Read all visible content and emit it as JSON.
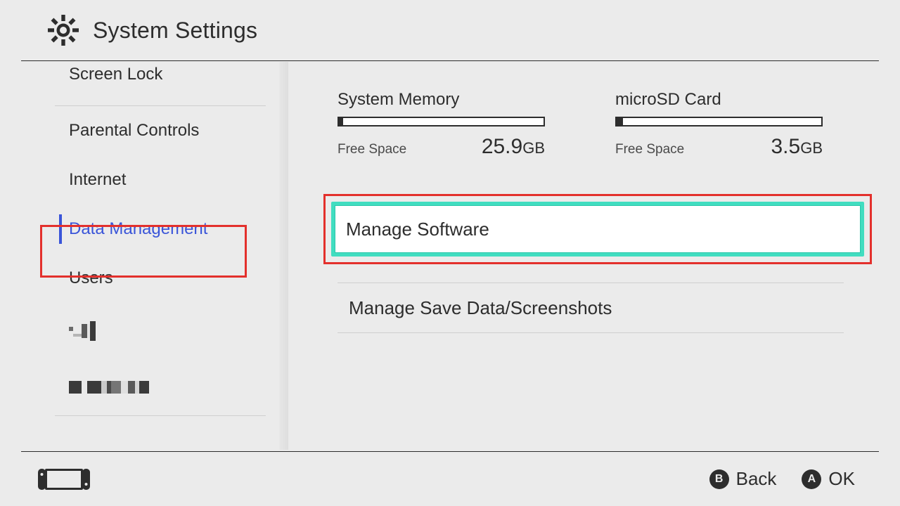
{
  "header": {
    "title": "System Settings"
  },
  "sidebar": {
    "items": [
      {
        "label": "Screen Lock"
      },
      {
        "label": "Parental Controls"
      },
      {
        "label": "Internet"
      },
      {
        "label": "Data Management"
      },
      {
        "label": "Users"
      }
    ]
  },
  "storage": {
    "system": {
      "title": "System Memory",
      "free_label": "Free Space",
      "free_value": "25.9",
      "free_unit": "GB",
      "used_pct": 2
    },
    "sd": {
      "title": "microSD Card",
      "free_label": "Free Space",
      "free_value": "3.5",
      "free_unit": "GB",
      "used_pct": 3
    }
  },
  "options": {
    "manage_software": "Manage Software",
    "manage_save": "Manage Save Data/Screenshots"
  },
  "footer": {
    "back_key": "B",
    "back_label": "Back",
    "ok_key": "A",
    "ok_label": "OK"
  },
  "colors": {
    "accent_blue": "#3a55d9",
    "focus_teal": "#41ddc0",
    "annotation_red": "#e3302c"
  }
}
